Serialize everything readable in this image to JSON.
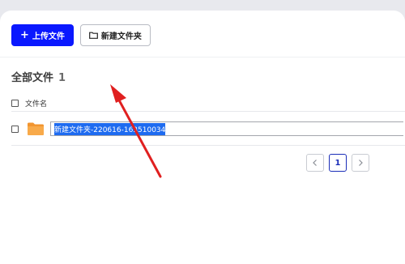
{
  "toolbar": {
    "upload_label": "上传文件",
    "upload_icon": "plus-icon",
    "new_folder_label": "新建文件夹",
    "new_folder_icon": "folder-outline-icon"
  },
  "header": {
    "title": "全部文件",
    "count": "1"
  },
  "table": {
    "columns": [
      "文件名"
    ],
    "rows": [
      {
        "icon": "folder-icon",
        "name_value": "新建文件夹-220616-163510034",
        "editing": true
      }
    ]
  },
  "pagination": {
    "prev_icon": "chevron-left-icon",
    "current_page": "1",
    "next_icon": "chevron-right-icon"
  },
  "colors": {
    "primary": "#0a18ff",
    "folder": "#f5a03c",
    "selection": "#1e6bf0",
    "annotation_arrow": "#e02020"
  }
}
